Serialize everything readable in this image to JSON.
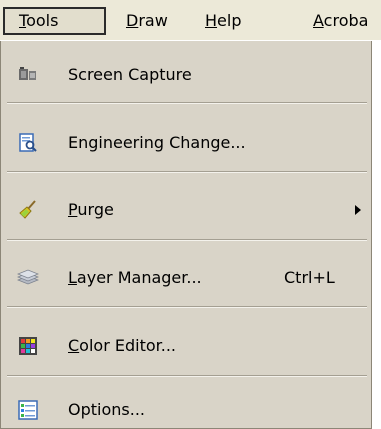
{
  "menubar": {
    "items": [
      {
        "label": "Tools",
        "mnemonic": "T",
        "rest": "ools",
        "active": true
      },
      {
        "label": "Draw",
        "mnemonic": "D",
        "rest": "raw",
        "active": false
      },
      {
        "label": "Help",
        "mnemonic": "H",
        "rest": "elp",
        "active": false
      },
      {
        "label": "Acroba",
        "mnemonic": "A",
        "rest": "croba",
        "active": false
      }
    ]
  },
  "menu": {
    "items": [
      {
        "label": "Screen Capture",
        "icon": "camera-icon"
      },
      {
        "label": "Engineering Change...",
        "icon": "document-search-icon"
      },
      {
        "label": "Purge",
        "mnemonic": "P",
        "rest": "urge",
        "icon": "broom-icon",
        "has_submenu": true
      },
      {
        "label": "Layer Manager...",
        "mnemonic": "L",
        "rest": "ayer Manager...",
        "shortcut": "Ctrl+L",
        "icon": "layers-icon"
      },
      {
        "label": "Color Editor...",
        "mnemonic": "C",
        "rest": "olor Editor...",
        "icon": "color-grid-icon"
      },
      {
        "label": "Options...",
        "icon": "options-list-icon"
      }
    ]
  }
}
